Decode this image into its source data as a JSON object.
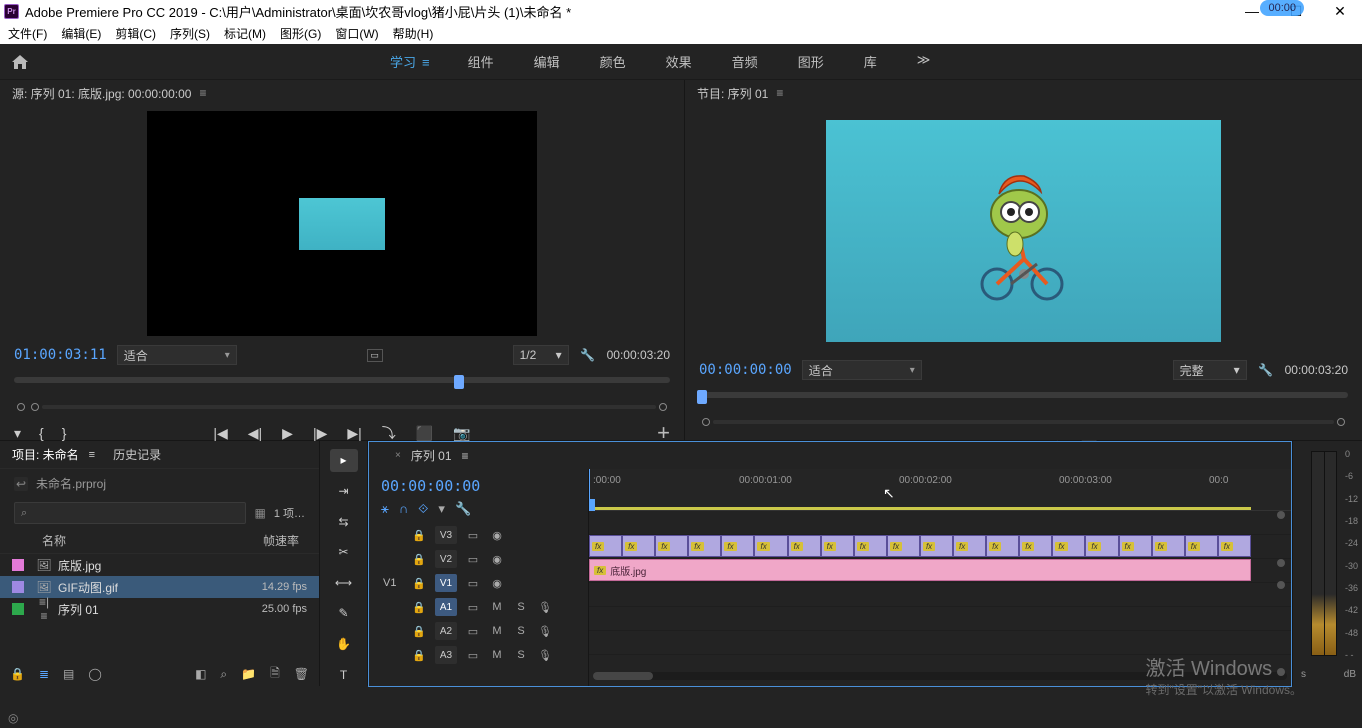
{
  "titlebar": {
    "app": "Adobe Premiere Pro CC 2019 - C:\\用户\\Administrator\\桌面\\坎农哥vlog\\猪小屁\\片头 (1)\\未命名 *",
    "badge": "00:00"
  },
  "menubar": {
    "items": [
      "文件(F)",
      "编辑(E)",
      "剪辑(C)",
      "序列(S)",
      "标记(M)",
      "图形(G)",
      "窗口(W)",
      "帮助(H)"
    ]
  },
  "workspaces": {
    "items": [
      "学习",
      "组件",
      "编辑",
      "颜色",
      "效果",
      "音频",
      "图形",
      "库"
    ],
    "active_index": 0
  },
  "source": {
    "title": "源: 序列 01: 底版.jpg: 00:00:00:00",
    "tc_left": "01:00:03:11",
    "fit": "适合",
    "half": "1/2",
    "tc_right": "00:00:03:20"
  },
  "program": {
    "title": "节目: 序列 01",
    "tc_left": "00:00:00:00",
    "fit": "适合",
    "full": "完整",
    "tc_right": "00:00:03:20"
  },
  "project": {
    "tabs": [
      "项目: 未命名",
      "历史记录"
    ],
    "active_tab": 0,
    "path": "未命名.prproj",
    "count": "1 项…",
    "headers": {
      "name": "名称",
      "rate": "帧速率"
    },
    "items": [
      {
        "swatch": "#e37ad8",
        "name": "底版.jpg",
        "rate": "",
        "icon": "🖼"
      },
      {
        "swatch": "#9e89e3",
        "name": "GIF动图.gif",
        "rate": "14.29 fps",
        "icon": "🖼",
        "selected": true
      },
      {
        "swatch": "#2da84c",
        "name": "序列 01",
        "rate": "25.00 fps",
        "icon": "≡"
      }
    ]
  },
  "timeline": {
    "title": "序列 01",
    "tc": "00:00:00:00",
    "ticks": [
      ":00:00",
      "00:00:01:00",
      "00:00:02:00",
      "00:00:03:00",
      "00:0"
    ],
    "video_tracks": [
      {
        "lbl": "",
        "num": "V3"
      },
      {
        "lbl": "",
        "num": "V2"
      },
      {
        "lbl": "V1",
        "num": "V1",
        "active": true
      }
    ],
    "audio_tracks": [
      {
        "lbl": "",
        "num": "A1",
        "active": true
      },
      {
        "lbl": "",
        "num": "A2"
      },
      {
        "lbl": "",
        "num": "A3"
      }
    ],
    "v1_clip": "底版.jpg",
    "fx": "fx"
  },
  "meter": {
    "scale": [
      "0",
      "-6",
      "-12",
      "-18",
      "-24",
      "-30",
      "-36",
      "-42",
      "-48",
      "- -"
    ],
    "db": "dB",
    "s": "s"
  },
  "watermark": {
    "title": "激活 Windows",
    "sub": "转到\"设置\"以激活 Windows。"
  }
}
